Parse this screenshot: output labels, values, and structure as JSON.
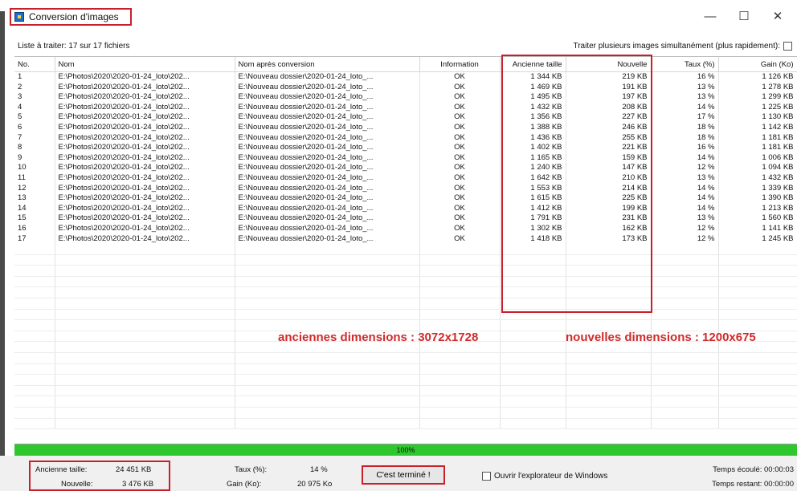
{
  "window": {
    "title": "Conversion d'images",
    "minimize": "—",
    "maximize": "☐",
    "close": "✕"
  },
  "list_info": "Liste à traiter: 17 sur 17 fichiers",
  "option_parallel": "Traiter plusieurs images simultanément (plus rapidement):",
  "columns": [
    "No.",
    "Nom",
    "Nom après conversion",
    "Information",
    "Ancienne taille",
    "Nouvelle",
    "Taux (%)",
    "Gain (Ko)"
  ],
  "rows": [
    [
      "1",
      "E:\\Photos\\2020\\2020-01-24_loto\\202...",
      "E:\\Nouveau dossier\\2020-01-24_loto_...",
      "OK",
      "1 344 KB",
      "219 KB",
      "16 %",
      "1 126 KB"
    ],
    [
      "2",
      "E:\\Photos\\2020\\2020-01-24_loto\\202...",
      "E:\\Nouveau dossier\\2020-01-24_loto_...",
      "OK",
      "1 469 KB",
      "191 KB",
      "13 %",
      "1 278 KB"
    ],
    [
      "3",
      "E:\\Photos\\2020\\2020-01-24_loto\\202...",
      "E:\\Nouveau dossier\\2020-01-24_loto_...",
      "OK",
      "1 495 KB",
      "197 KB",
      "13 %",
      "1 299 KB"
    ],
    [
      "4",
      "E:\\Photos\\2020\\2020-01-24_loto\\202...",
      "E:\\Nouveau dossier\\2020-01-24_loto_...",
      "OK",
      "1 432 KB",
      "208 KB",
      "14 %",
      "1 225 KB"
    ],
    [
      "5",
      "E:\\Photos\\2020\\2020-01-24_loto\\202...",
      "E:\\Nouveau dossier\\2020-01-24_loto_...",
      "OK",
      "1 356 KB",
      "227 KB",
      "17 %",
      "1 130 KB"
    ],
    [
      "6",
      "E:\\Photos\\2020\\2020-01-24_loto\\202...",
      "E:\\Nouveau dossier\\2020-01-24_loto_...",
      "OK",
      "1 388 KB",
      "246 KB",
      "18 %",
      "1 142 KB"
    ],
    [
      "7",
      "E:\\Photos\\2020\\2020-01-24_loto\\202...",
      "E:\\Nouveau dossier\\2020-01-24_loto_...",
      "OK",
      "1 436 KB",
      "255 KB",
      "18 %",
      "1 181 KB"
    ],
    [
      "8",
      "E:\\Photos\\2020\\2020-01-24_loto\\202...",
      "E:\\Nouveau dossier\\2020-01-24_loto_...",
      "OK",
      "1 402 KB",
      "221 KB",
      "16 %",
      "1 181 KB"
    ],
    [
      "9",
      "E:\\Photos\\2020\\2020-01-24_loto\\202...",
      "E:\\Nouveau dossier\\2020-01-24_loto_...",
      "OK",
      "1 165 KB",
      "159 KB",
      "14 %",
      "1 006 KB"
    ],
    [
      "10",
      "E:\\Photos\\2020\\2020-01-24_loto\\202...",
      "E:\\Nouveau dossier\\2020-01-24_loto_...",
      "OK",
      "1 240 KB",
      "147 KB",
      "12 %",
      "1 094 KB"
    ],
    [
      "11",
      "E:\\Photos\\2020\\2020-01-24_loto\\202...",
      "E:\\Nouveau dossier\\2020-01-24_loto_...",
      "OK",
      "1 642 KB",
      "210 KB",
      "13 %",
      "1 432 KB"
    ],
    [
      "12",
      "E:\\Photos\\2020\\2020-01-24_loto\\202...",
      "E:\\Nouveau dossier\\2020-01-24_loto_...",
      "OK",
      "1 553 KB",
      "214 KB",
      "14 %",
      "1 339 KB"
    ],
    [
      "13",
      "E:\\Photos\\2020\\2020-01-24_loto\\202...",
      "E:\\Nouveau dossier\\2020-01-24_loto_...",
      "OK",
      "1 615 KB",
      "225 KB",
      "14 %",
      "1 390 KB"
    ],
    [
      "14",
      "E:\\Photos\\2020\\2020-01-24_loto\\202...",
      "E:\\Nouveau dossier\\2020-01-24_loto_...",
      "OK",
      "1 412 KB",
      "199 KB",
      "14 %",
      "1 213 KB"
    ],
    [
      "15",
      "E:\\Photos\\2020\\2020-01-24_loto\\202...",
      "E:\\Nouveau dossier\\2020-01-24_loto_...",
      "OK",
      "1 791 KB",
      "231 KB",
      "13 %",
      "1 560 KB"
    ],
    [
      "16",
      "E:\\Photos\\2020\\2020-01-24_loto\\202...",
      "E:\\Nouveau dossier\\2020-01-24_loto_...",
      "OK",
      "1 302 KB",
      "162 KB",
      "12 %",
      "1 141 KB"
    ],
    [
      "17",
      "E:\\Photos\\2020\\2020-01-24_loto\\202...",
      "E:\\Nouveau dossier\\2020-01-24_loto_...",
      "OK",
      "1 418 KB",
      "173 KB",
      "12 %",
      "1 245 KB"
    ]
  ],
  "annotations": {
    "old_dims": "anciennes dimensions : 3072x1728",
    "new_dims": "nouvelles dimensions : 1200x675"
  },
  "progress": {
    "value": 1.0,
    "label": "100%",
    "color": "#2ec82e"
  },
  "footer": {
    "old_size_label": "Ancienne taille:",
    "old_size_value": "24 451 KB",
    "new_size_label": "Nouvelle:",
    "new_size_value": "3 476 KB",
    "rate_label": "Taux (%):",
    "rate_value": "14 %",
    "gain_label": "Gain (Ko):",
    "gain_value": "20 975 Ko",
    "done_button": "C'est terminé !",
    "explorer_label": "Ouvrir l'explorateur de Windows",
    "elapsed": "Temps écoulé: 00:00:03",
    "remaining": "Temps restant: 00:00:00"
  },
  "colors": {
    "highlight": "#c8202a",
    "annotation": "#d12a2a"
  }
}
